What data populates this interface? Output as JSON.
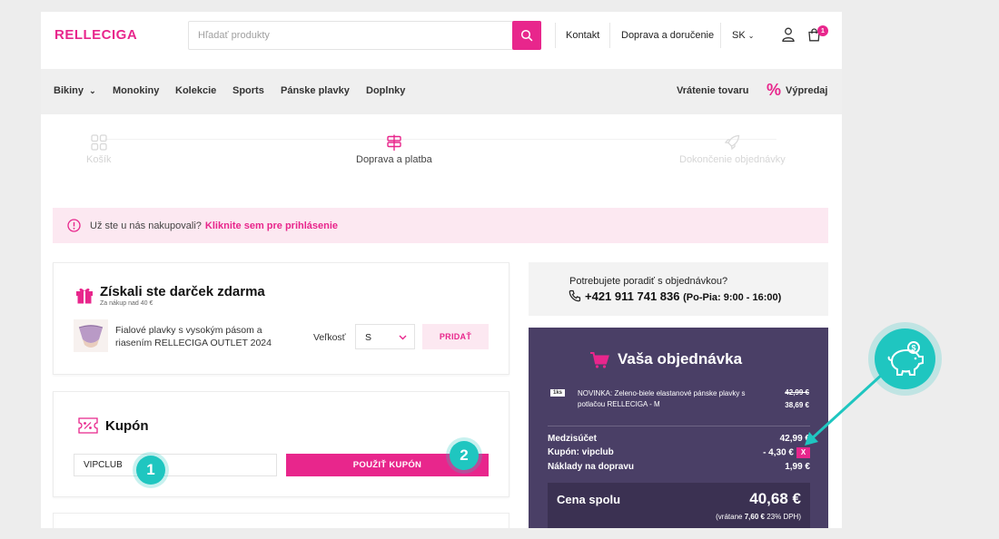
{
  "header": {
    "logo": "RELLECIGA",
    "search_placeholder": "Hľadať produkty",
    "links": [
      "Kontakt",
      "Doprava a doručenie"
    ],
    "language": "SK",
    "cart_count": "1"
  },
  "nav": {
    "items": [
      "Bikiny",
      "Monokiny",
      "Kolekcie",
      "Sports",
      "Pánske plavky",
      "Doplnky"
    ],
    "returns": "Vrátenie tovaru",
    "sale": "Výpredaj"
  },
  "steps": [
    "Košík",
    "Doprava a platba",
    "Dokončenie objednávky"
  ],
  "notice": {
    "text": "Už ste u nás nakupovali?",
    "link": "Kliknite sem pre prihlásenie"
  },
  "gift": {
    "title": "Získali ste darček zdarma",
    "subtitle": "Za nákup nad 40 €",
    "product": "Fialové plavky s vysokým pásom a riasením RELLECIGA OUTLET 2024",
    "size_label": "Veľkosť",
    "size_value": "S",
    "add_button": "PRIDAŤ"
  },
  "coupon": {
    "title": "Kupón",
    "input_value": "VIPCLUB",
    "apply_button": "POUŽIŤ KUPÓN"
  },
  "annotations": [
    "1",
    "2"
  ],
  "help": {
    "question": "Potrebujete poradiť s objednávkou?",
    "phone": "+421 911 741 836",
    "hours": "(Po-Pia: 9:00 - 16:00)"
  },
  "order": {
    "title": "Vaša objednávka",
    "item": {
      "qty": "1ks",
      "name": "NOVINKA: Zeleno-biele elastanové pánske plavky s potlačou RELLECIGA - M",
      "old_price": "42,99 €",
      "new_price": "38,69 €"
    },
    "subtotal_label": "Medzisúčet",
    "subtotal_value": "42,99 €",
    "coupon_label": "Kupón: vipclub",
    "coupon_value": "- 4,30 €",
    "coupon_remove": "X",
    "shipping_label": "Náklady na dopravu",
    "shipping_value": "1,99 €",
    "total_label": "Cena spolu",
    "total_value": "40,68 €",
    "vat_prefix": "(vrátane",
    "vat_amount": "7,60 €",
    "vat_suffix": "23% DPH)"
  },
  "colors": {
    "brand": "#e8268c",
    "accent": "#1fc6c0",
    "order_bg": "#4a3f66"
  }
}
